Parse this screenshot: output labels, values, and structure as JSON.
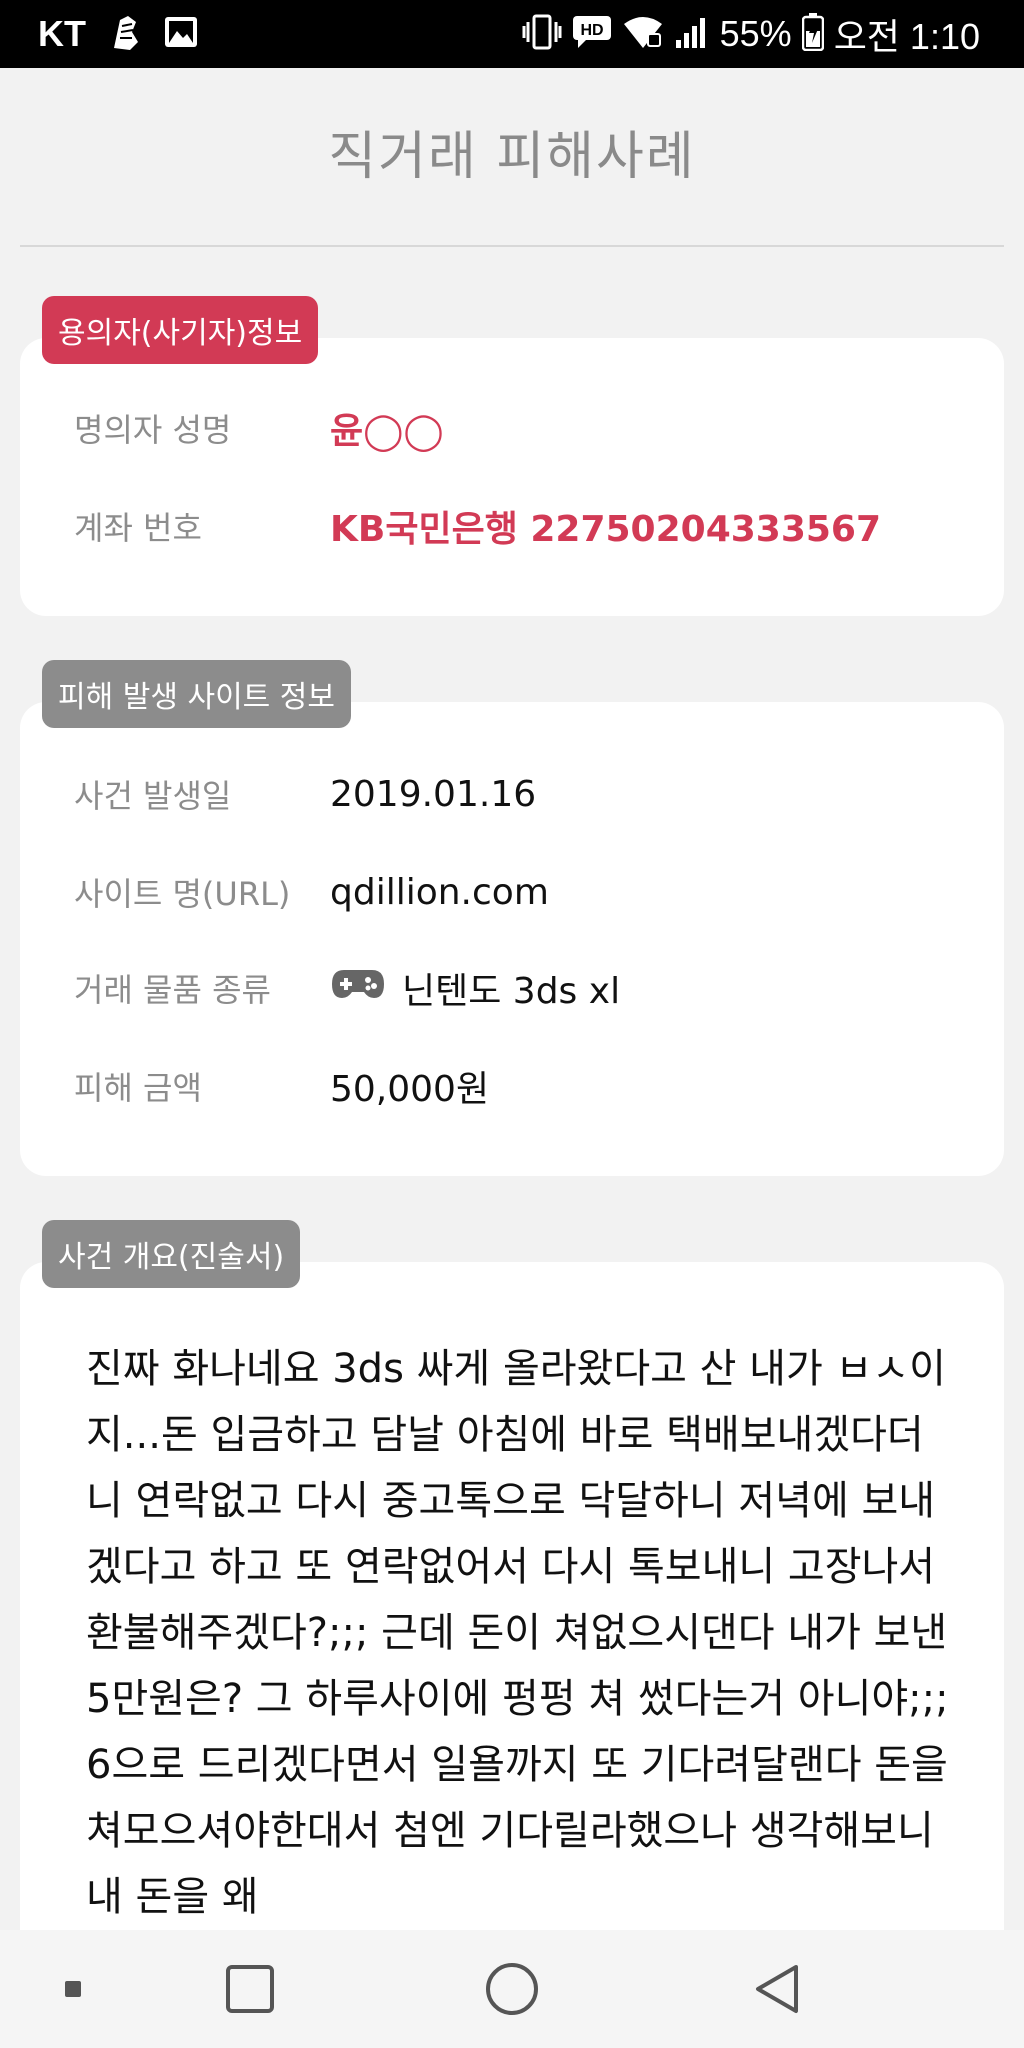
{
  "status_bar": {
    "carrier": "KT",
    "battery": "55%",
    "time": "오전 1:10",
    "icons": [
      "running-shoe-icon",
      "image-icon",
      "vibrate-icon",
      "hd-icon",
      "wifi-icon",
      "signal-icon",
      "battery-icon"
    ]
  },
  "header": {
    "title": "직거래 피해사례"
  },
  "suspect": {
    "badge": "용의자(사기자)정보",
    "name_label": "명의자 성명",
    "name_value": "윤◯◯",
    "account_label": "계좌 번호",
    "account_value": "KB국민은행 22750204333567"
  },
  "site": {
    "badge": "피해 발생 사이트 정보",
    "date_label": "사건 발생일",
    "date_value": "2019.01.16",
    "url_label": "사이트 명(URL)",
    "url_value": "qdillion.com",
    "item_label": "거래 물품 종류",
    "item_icon": "gamepad-icon",
    "item_value": "닌텐도 3ds xl",
    "amount_label": "피해 금액",
    "amount_value": "50,000원"
  },
  "statement": {
    "badge": "사건 개요(진술서)",
    "text": "진짜 화나네요 3ds 싸게 올라왔다고 산 내가 ㅂㅅ이지...돈 입금하고 담날 아침에 바로 택배보내겠다더니 연락없고 다시 중고톡으로 닥달하니 저녁에 보내겠다고 하고 또 연락없어서 다시 톡보내니 고장나서 환불해주겠다?;;; 근데 돈이 쳐없으시댄다 내가 보낸 5만원은? 그 하루사이에 펑펑 쳐 썼다는거 아니야;;; 6으로 드리겠다면서 일욜까지 또 기다려달랜다 돈을 쳐모으셔야한대서 첨엔 기다릴라했으나 생각해보니 내 돈을 왜"
  },
  "navbar": {
    "buttons": [
      "recent-apps-dot-icon",
      "overview-square-icon",
      "home-circle-icon",
      "back-triangle-icon"
    ]
  },
  "colors": {
    "accent_red": "#d23a55",
    "badge_gray": "#8c8c8c",
    "background": "#f2f2f2"
  }
}
